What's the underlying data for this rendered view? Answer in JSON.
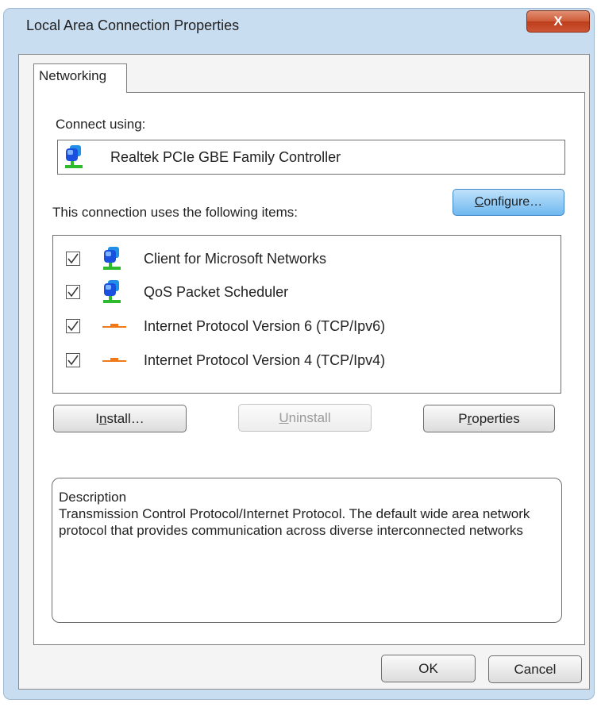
{
  "window": {
    "title": "Local Area Connection Properties",
    "close_label": "X"
  },
  "tabs": [
    {
      "label": "Networking",
      "selected": true
    }
  ],
  "connect_using": {
    "label": "Connect using:",
    "adapter_name": "Realtek PCIe GBE Family Controller",
    "adapter_icon": "network-adapter-icon",
    "configure": {
      "mnemonic": "C",
      "rest": "onfigure…"
    }
  },
  "items_section": {
    "label": "This connection uses the following items:",
    "items": [
      {
        "label": "Client for Microsoft Networks",
        "checked": true,
        "icon": "network-client-icon"
      },
      {
        "label": "QoS Packet Scheduler",
        "checked": true,
        "icon": "network-client-icon"
      },
      {
        "label": "Internet Protocol Version 6 (TCP/Ipv6)",
        "checked": true,
        "icon": "protocol-icon"
      },
      {
        "label": "Internet Protocol Version 4 (TCP/Ipv4)",
        "checked": true,
        "icon": "protocol-icon"
      }
    ]
  },
  "buttons": {
    "install": {
      "pre": "I",
      "mnemonic": "n",
      "rest": "stall…"
    },
    "uninstall": {
      "mnemonic": "U",
      "rest": "ninstall",
      "enabled": false
    },
    "properties": {
      "pre": "P",
      "mnemonic": "r",
      "rest": "operties"
    },
    "ok": "OK",
    "cancel": "Cancel"
  },
  "description": {
    "heading": "Description",
    "text": "Transmission Control Protocol/Internet Protocol. The default wide area network protocol that provides communication across diverse interconnected networks"
  },
  "colors": {
    "titlebar": "#c9ddf1",
    "close_button": "#c7472a",
    "configure_button": "#6fb8ef",
    "protocol_icon": "#f07a1a",
    "network_icon_blue": "#1a4fe0",
    "network_icon_green": "#2dbb2d"
  }
}
